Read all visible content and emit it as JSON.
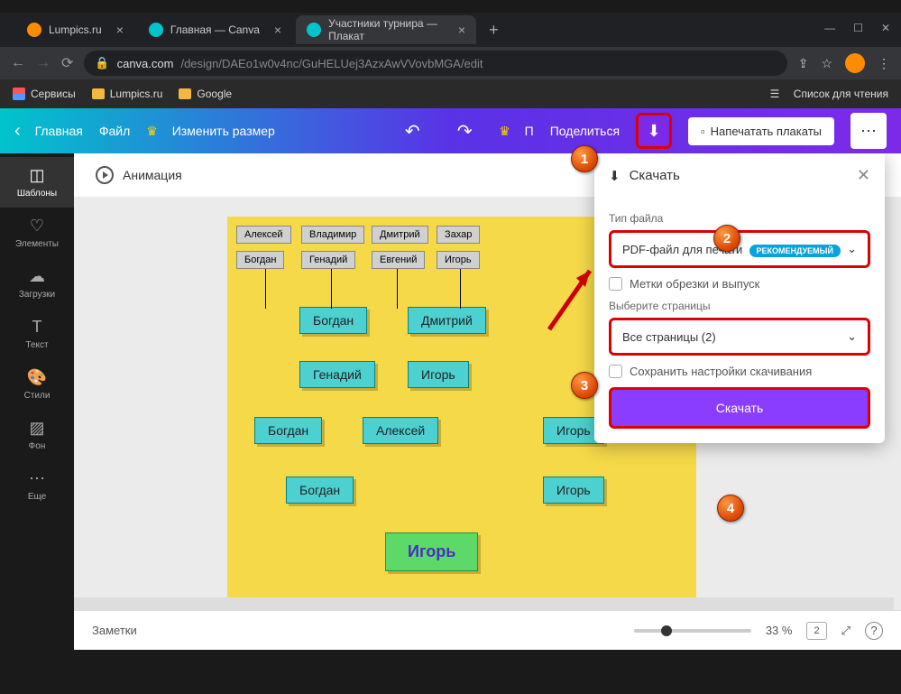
{
  "window": {
    "minimize": "—",
    "maximize": "☐",
    "close": "✕"
  },
  "tabs": [
    {
      "title": "Lumpics.ru",
      "icon": "#ff8c00"
    },
    {
      "title": "Главная — Canva",
      "icon": "#00c4cc"
    },
    {
      "title": "Участники турнира — Плакат",
      "icon": "#00c4cc",
      "active": true
    }
  ],
  "newtab": "+",
  "url": {
    "domain": "canva.com",
    "path": "/design/DAEo1w0v4nc/GuHELUej3AzxAwVVovbMGA/edit",
    "lock": "🔒"
  },
  "bookmarks": {
    "services": "Сервисы",
    "lumpics": "Lumpics.ru",
    "google": "Google",
    "readlist": "Список для чтения",
    "readicon": "☰"
  },
  "header": {
    "back": "‹",
    "home": "Главная",
    "file": "Файл",
    "resize": "Изменить размер",
    "crown": "♛",
    "undo": "↶",
    "redo": "↷",
    "premium": "П",
    "share": "Поделиться",
    "download_icon": "⬇",
    "print": "Напечатать плакаты",
    "print_icon": "▫",
    "more": "⋯"
  },
  "sidebar": [
    {
      "icon": "◫",
      "label": "Шаблоны",
      "active": true
    },
    {
      "icon": "♡",
      "label": "Элементы"
    },
    {
      "icon": "☁",
      "label": "Загрузки"
    },
    {
      "icon": "T",
      "label": "Текст"
    },
    {
      "icon": "🎨",
      "label": "Стили"
    },
    {
      "icon": "▨",
      "label": "Фон"
    },
    {
      "icon": "⋯",
      "label": "Еще"
    }
  ],
  "animation": "Анимация",
  "bracket": {
    "row1": [
      "Алексей",
      "Владимир",
      "Дмитрий",
      "Захар"
    ],
    "row2": [
      "Богдан",
      "Генадий",
      "Евгений",
      "Игорь"
    ],
    "r16": [
      "Богдан",
      "Дмитрий"
    ],
    "r8": [
      "Генадий",
      "Игорь"
    ],
    "r4": [
      "Богдан",
      "Алексей",
      "Игорь"
    ],
    "r2": [
      "Богдан",
      "Игорь"
    ],
    "final": "Игорь"
  },
  "panel": {
    "title": "Скачать",
    "title_icon": "⬇",
    "close": "✕",
    "filetype_label": "Тип файла",
    "filetype_value": "PDF-файл для печати",
    "filetype_badge": "РЕКОМЕНДУЕМЫЙ",
    "crop": "Метки обрезки и выпуск",
    "pages_label": "Выберите страницы",
    "pages_value": "Все страницы (2)",
    "save_settings": "Сохранить настройки скачивания",
    "button": "Скачать",
    "chevron": "⌄"
  },
  "markers": {
    "1": "1",
    "2": "2",
    "3": "3",
    "4": "4"
  },
  "bottom": {
    "notes": "Заметки",
    "zoom": "33 %",
    "pages": "2",
    "expand": "⤢",
    "help": "?"
  }
}
